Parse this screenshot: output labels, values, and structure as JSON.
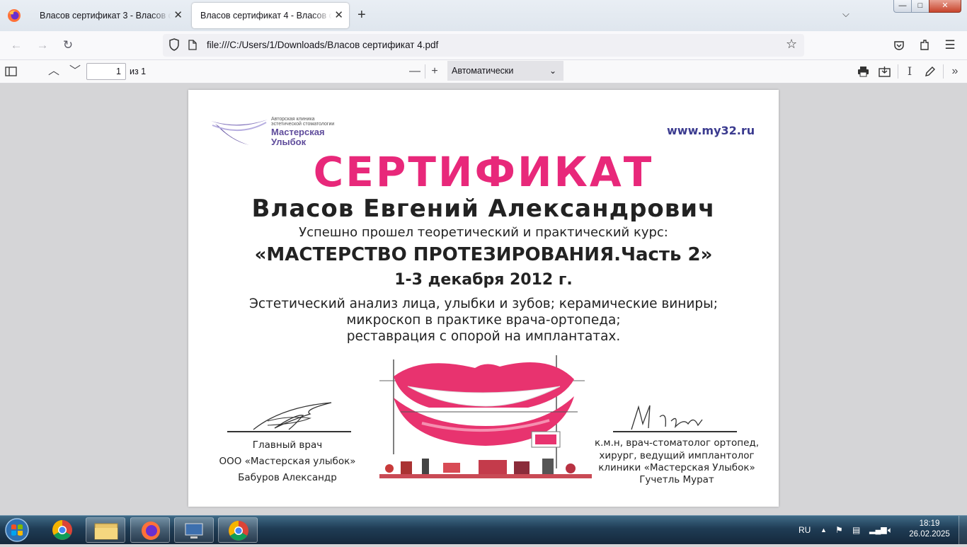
{
  "browser": {
    "tabs": [
      {
        "label": "Власов сертификат 3 - Власов сертификат 3",
        "active": false
      },
      {
        "label": "Власов сертификат 4 - Власов сертификат 4",
        "active": true
      }
    ],
    "url": "file:///C:/Users/1/Downloads/Власов сертификат 4.pdf"
  },
  "pdf_toolbar": {
    "page_number": "1",
    "page_count": "из 1",
    "zoom": "Автоматически"
  },
  "document": {
    "logo_small": "Авторская клиника эстетической стоматологии",
    "logo_name": "Мастерская Улыбок",
    "website": "www.my32.ru",
    "title": "СЕРТИФИКАТ",
    "recipient": "Власов Евгений Александрович",
    "completed": "Успешно прошел теоретический и практический курс:",
    "course": "«МАСТЕРСТВО ПРОТЕЗИРОВАНИЯ.Часть 2»",
    "dates": "1-3 декабря 2012 г.",
    "topics": [
      "Эстетический анализ лица, улыбки и зубов; керамические виниры;",
      "микроскоп в практике врача-ортопеда;",
      "реставрация с опорой на имплантатах."
    ],
    "left_signatory": [
      "Главный врач",
      "ООО «Мастерская улыбок»",
      "Бабуров Александр"
    ],
    "right_signatory": [
      "к.м.н, врач-стоматолог ортопед,",
      "хирург, ведущий имплантолог",
      "клиники «Мастерская Улыбок»",
      "Гучетль Мурат"
    ],
    "accent_color": "#e8287a"
  },
  "taskbar": {
    "language": "RU",
    "time": "18:19",
    "date": "26.02.2025"
  }
}
